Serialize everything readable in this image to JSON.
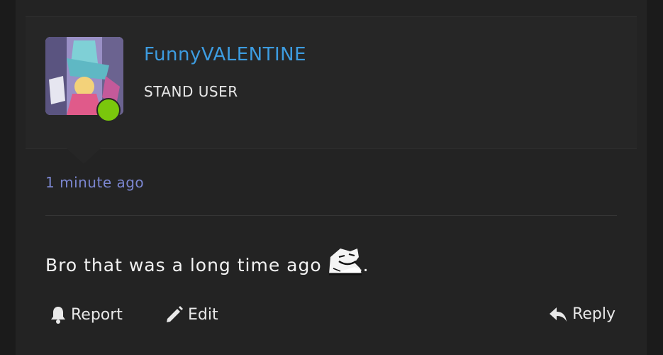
{
  "post": {
    "username": "FunnyVALENTINE",
    "user_title": "STAND USER",
    "timestamp": "1 minute ago",
    "message_text": "Bro that was a long time ago",
    "message_trailing": ".",
    "sticker": "smug-face-sticker",
    "online": true
  },
  "actions": {
    "report": "Report",
    "edit": "Edit",
    "reply": "Reply"
  },
  "icons": {
    "report": "bell-icon",
    "edit": "pencil-icon",
    "reply": "reply-arrow-icon"
  },
  "colors": {
    "username": "#3d9ce0",
    "timestamp": "#7b86d0",
    "online": "#7ac70c",
    "background": "#232323"
  }
}
